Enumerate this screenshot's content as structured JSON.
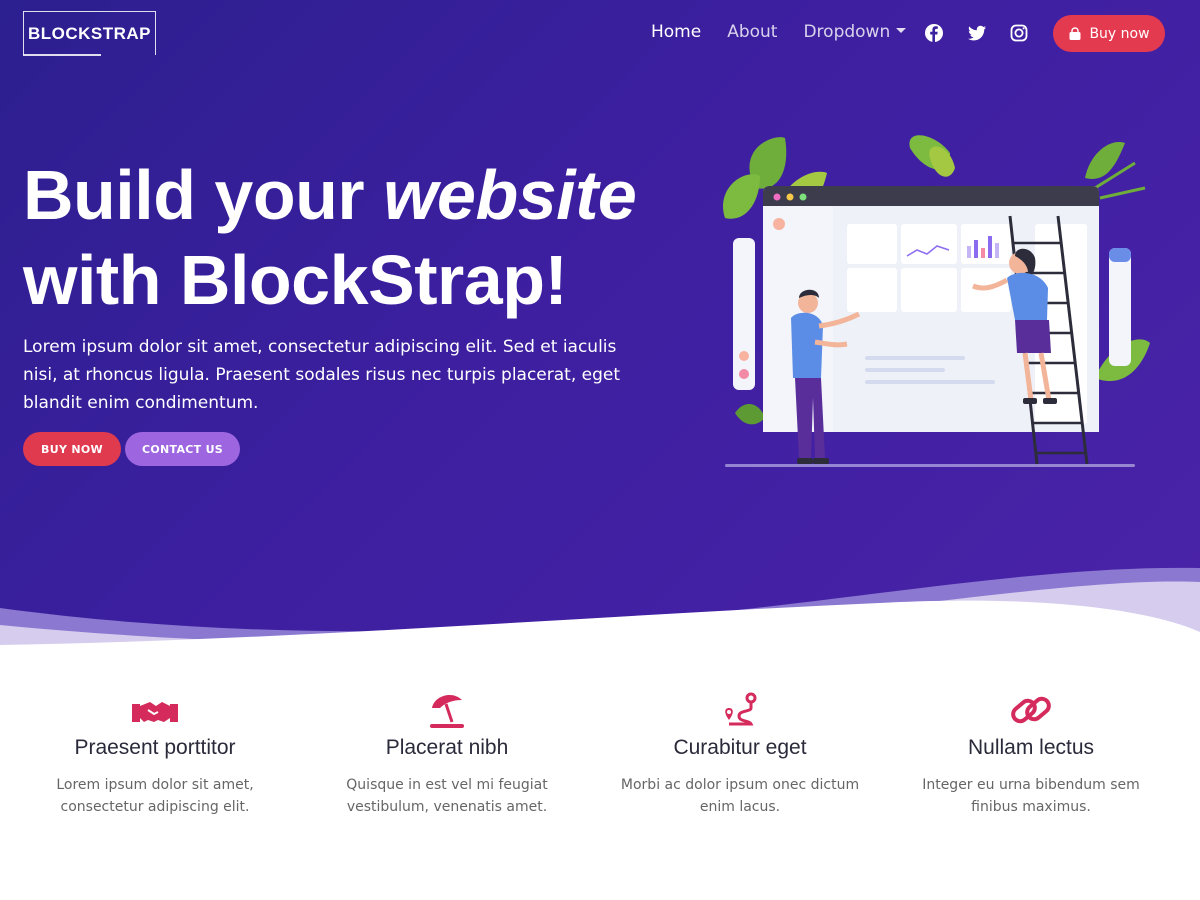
{
  "navbar": {
    "brand": "BLOCKSTRAP",
    "links": [
      "Home",
      "About",
      "Dropdown"
    ],
    "social_icons": [
      "facebook-icon",
      "twitter-icon",
      "instagram-icon"
    ],
    "buy_label": "Buy now"
  },
  "hero": {
    "title_line1_a": "Build your ",
    "title_line1_b": "website",
    "title_line2": "with BlockStrap!",
    "lead": "Lorem ipsum dolor sit amet, consectetur adipiscing elit. Sed et iaculis nisi, at rhoncus ligula. Praesent sodales risus nec turpis placerat, eget blandit enim condimentum.",
    "buttons": {
      "buy": "BUY NOW",
      "contact": "CONTACT US"
    }
  },
  "features": [
    {
      "icon": "handshake-icon",
      "title": "Praesent porttitor",
      "text": "Lorem ipsum dolor sit amet, consectetur adipiscing elit."
    },
    {
      "icon": "beach-umbrella-icon",
      "title": "Placerat nibh",
      "text": "Quisque in est vel mi feugiat vestibulum, venenatis amet."
    },
    {
      "icon": "route-icon",
      "title": "Curabitur eget",
      "text": "Morbi ac dolor ipsum onec dictum enim lacus."
    },
    {
      "icon": "link-icon",
      "title": "Nullam lectus",
      "text": "Integer eu urna bibendum sem finibus maximus."
    }
  ],
  "colors": {
    "hero_gradient_start": "#2c1f8f",
    "hero_gradient_end": "#4a23a8",
    "accent_red": "#e43a4f",
    "accent_purple": "#9d66e0",
    "icon_pink": "#d42a5c"
  }
}
